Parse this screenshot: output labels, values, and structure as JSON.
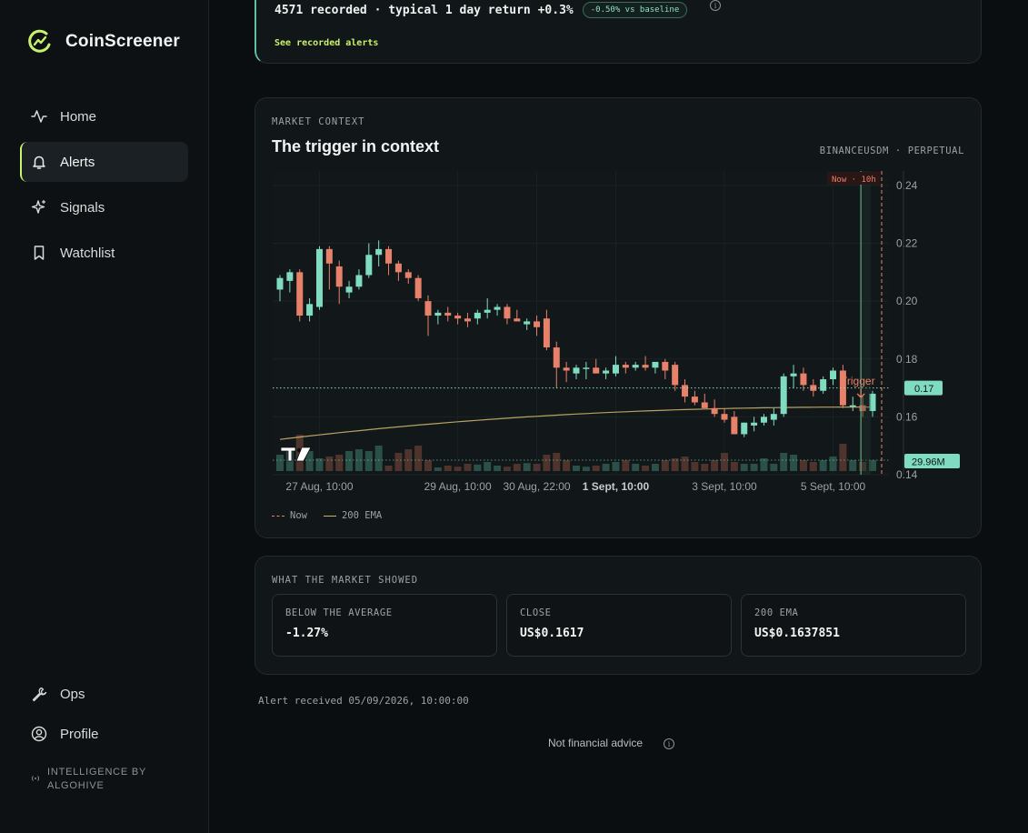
{
  "app": {
    "name": "CoinScreener"
  },
  "sidebar": {
    "items": [
      {
        "label": "Home",
        "icon": "activity-icon",
        "active": false
      },
      {
        "label": "Alerts",
        "icon": "bell-icon",
        "active": true
      },
      {
        "label": "Signals",
        "icon": "sparkles-icon",
        "active": false
      },
      {
        "label": "Watchlist",
        "icon": "bookmark-icon",
        "active": false
      }
    ],
    "bottom_items": [
      {
        "label": "Ops",
        "icon": "wrench-icon"
      },
      {
        "label": "Profile",
        "icon": "user-circle-icon"
      }
    ],
    "footer_line1": "INTELLIGENCE BY",
    "footer_line2": "ALGOHIVE"
  },
  "summary": {
    "text": "4571 recorded · typical 1 day return +0.3%",
    "badge": "-0.50% vs baseline",
    "link": "See recorded alerts"
  },
  "context": {
    "eyebrow": "MARKET CONTEXT",
    "title": "The trigger in context",
    "exchange": "BINANCEUSDM · PERPETUAL",
    "now_label": "Now · 10h",
    "trigger_label": "Trigger",
    "price_tag": "0.17",
    "volume_tag": "29.96M",
    "legend_now": "Now",
    "legend_ema": "200 EMA"
  },
  "chart_data": {
    "type": "candlestick",
    "ylim": [
      0.14,
      0.245
    ],
    "y_ticks": [
      "0.24",
      "0.22",
      "0.20",
      "0.18",
      "0.16",
      "0.14"
    ],
    "x_ticks": [
      "27 Aug, 10:00",
      "29 Aug, 10:00",
      "30 Aug, 22:00",
      "1 Sept, 10:00",
      "3 Sept, 10:00",
      "5 Sept, 10:00"
    ],
    "candles": [
      [
        0.204,
        0.209,
        0.2,
        0.208
      ],
      [
        0.207,
        0.211,
        0.203,
        0.21
      ],
      [
        0.21,
        0.211,
        0.193,
        0.195
      ],
      [
        0.195,
        0.201,
        0.193,
        0.199
      ],
      [
        0.198,
        0.219,
        0.197,
        0.218
      ],
      [
        0.218,
        0.219,
        0.204,
        0.213
      ],
      [
        0.212,
        0.214,
        0.199,
        0.205
      ],
      [
        0.203,
        0.207,
        0.201,
        0.205
      ],
      [
        0.205,
        0.211,
        0.204,
        0.209
      ],
      [
        0.209,
        0.22,
        0.208,
        0.216
      ],
      [
        0.216,
        0.221,
        0.212,
        0.218
      ],
      [
        0.218,
        0.219,
        0.209,
        0.213
      ],
      [
        0.213,
        0.214,
        0.207,
        0.21
      ],
      [
        0.21,
        0.211,
        0.206,
        0.208
      ],
      [
        0.208,
        0.209,
        0.2,
        0.201
      ],
      [
        0.2,
        0.202,
        0.188,
        0.195
      ],
      [
        0.195,
        0.197,
        0.192,
        0.196
      ],
      [
        0.196,
        0.198,
        0.193,
        0.195
      ],
      [
        0.195,
        0.196,
        0.192,
        0.194
      ],
      [
        0.194,
        0.196,
        0.191,
        0.193
      ],
      [
        0.194,
        0.197,
        0.192,
        0.196
      ],
      [
        0.196,
        0.201,
        0.194,
        0.197
      ],
      [
        0.197,
        0.199,
        0.195,
        0.198
      ],
      [
        0.198,
        0.199,
        0.192,
        0.194
      ],
      [
        0.194,
        0.197,
        0.193,
        0.193
      ],
      [
        0.192,
        0.194,
        0.19,
        0.193
      ],
      [
        0.193,
        0.195,
        0.188,
        0.191
      ],
      [
        0.194,
        0.197,
        0.183,
        0.184
      ],
      [
        0.184,
        0.186,
        0.17,
        0.177
      ],
      [
        0.177,
        0.179,
        0.172,
        0.176
      ],
      [
        0.175,
        0.178,
        0.173,
        0.177
      ],
      [
        0.177,
        0.179,
        0.173,
        0.177
      ],
      [
        0.177,
        0.18,
        0.175,
        0.175
      ],
      [
        0.175,
        0.177,
        0.173,
        0.176
      ],
      [
        0.175,
        0.181,
        0.174,
        0.178
      ],
      [
        0.178,
        0.179,
        0.175,
        0.177
      ],
      [
        0.177,
        0.179,
        0.176,
        0.178
      ],
      [
        0.178,
        0.181,
        0.176,
        0.177
      ],
      [
        0.177,
        0.179,
        0.175,
        0.179
      ],
      [
        0.179,
        0.18,
        0.173,
        0.176
      ],
      [
        0.178,
        0.179,
        0.169,
        0.171
      ],
      [
        0.171,
        0.173,
        0.165,
        0.167
      ],
      [
        0.167,
        0.169,
        0.164,
        0.165
      ],
      [
        0.165,
        0.168,
        0.163,
        0.163
      ],
      [
        0.163,
        0.166,
        0.16,
        0.161
      ],
      [
        0.161,
        0.163,
        0.158,
        0.159
      ],
      [
        0.16,
        0.162,
        0.154,
        0.154
      ],
      [
        0.154,
        0.158,
        0.153,
        0.158
      ],
      [
        0.157,
        0.16,
        0.155,
        0.158
      ],
      [
        0.158,
        0.161,
        0.157,
        0.16
      ],
      [
        0.159,
        0.163,
        0.157,
        0.161
      ],
      [
        0.161,
        0.175,
        0.16,
        0.174
      ],
      [
        0.174,
        0.178,
        0.17,
        0.175
      ],
      [
        0.175,
        0.177,
        0.169,
        0.171
      ],
      [
        0.171,
        0.173,
        0.167,
        0.169
      ],
      [
        0.169,
        0.174,
        0.168,
        0.173
      ],
      [
        0.173,
        0.177,
        0.171,
        0.176
      ],
      [
        0.176,
        0.178,
        0.163,
        0.164
      ],
      [
        0.164,
        0.167,
        0.162,
        0.164
      ],
      [
        0.164,
        0.167,
        0.16,
        0.162
      ],
      [
        0.162,
        0.169,
        0.16,
        0.168
      ]
    ],
    "volume_rel": [
      0.45,
      0.6,
      1.0,
      0.55,
      0.35,
      0.4,
      0.45,
      0.55,
      0.6,
      0.55,
      0.7,
      0.15,
      0.5,
      0.6,
      0.7,
      0.3,
      0.1,
      0.15,
      0.12,
      0.2,
      0.18,
      0.25,
      0.15,
      0.12,
      0.2,
      0.22,
      0.2,
      0.45,
      0.5,
      0.3,
      0.15,
      0.12,
      0.15,
      0.2,
      0.25,
      0.3,
      0.2,
      0.15,
      0.2,
      0.3,
      0.35,
      0.4,
      0.25,
      0.2,
      0.3,
      0.5,
      0.25,
      0.2,
      0.2,
      0.35,
      0.2,
      0.5,
      0.45,
      0.3,
      0.25,
      0.3,
      0.4,
      0.75,
      0.3,
      0.25,
      0.3
    ],
    "ema_200": {
      "start": 0.1522,
      "end": 0.1634
    },
    "trigger_index": 59
  },
  "market": {
    "eyebrow": "WHAT THE MARKET SHOWED",
    "metrics": [
      {
        "label": "BELOW THE AVERAGE",
        "value": "-1.27%"
      },
      {
        "label": "CLOSE",
        "value": "US$0.1617"
      },
      {
        "label": "200 EMA",
        "value": "US$0.1637851"
      }
    ]
  },
  "footer": {
    "received": "Alert received 05/09/2026, 10:00:00",
    "disclaimer": "Not financial advice"
  },
  "colors": {
    "accent": "#c9f26b",
    "bull": "#7fdcc0",
    "bear": "#e8816a",
    "ema": "#c9b36b"
  }
}
